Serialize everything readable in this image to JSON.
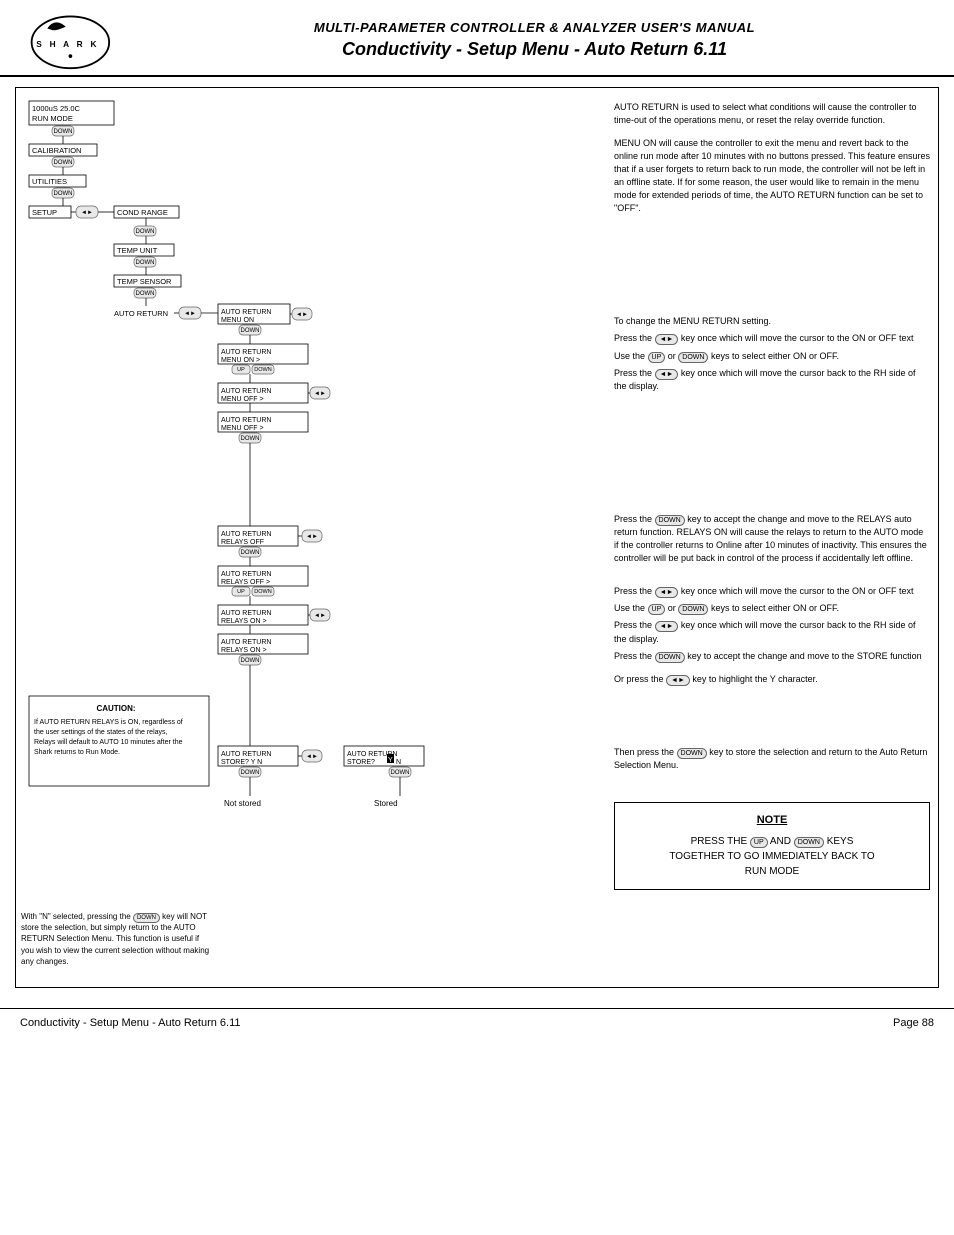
{
  "header": {
    "manual_title": "MULTI-PARAMETER CONTROLLER & ANALYZER USER'S MANUAL",
    "page_title": "Conductivity - Setup Menu - Auto Return 6.11",
    "logo_text": "SHARK"
  },
  "footer": {
    "left_text": "Conductivity - Setup Menu - Auto Return 6.11",
    "right_text": "Page 88"
  },
  "descriptions": {
    "auto_return_intro": "AUTO RETURN is used to select what conditions will cause the controller to time-out of the operations menu, or reset the relay override function.",
    "menu_on_desc": "MENU ON will cause the controller to exit the menu and revert back to the online run mode after 10 minutes with no buttons pressed. This feature ensures that if a user forgets to return back to run mode, the controller will not be left in an offline state. If for some reason, the user would like to remain in the menu mode for extended periods of time, the AUTO RETURN function can be set to \"OFF\".",
    "change_menu_return": "To change the MENU RETURN setting.",
    "press_enter_once": "Press the",
    "enter_key_label": "◄►",
    "move_cursor": "key once which will move the cursor to the ON or OFF text",
    "use_up_down": "Use the",
    "up_key": "▲",
    "or_text": "or",
    "down_key": "▼",
    "keys_text": "keys to select either ON or OFF.",
    "press_enter_rh": "Press the",
    "move_cursor_rh": "key once which will move the cursor back to the RH side of the display.",
    "press_down_accept": "Press the",
    "down_key2": "▼",
    "key_accept": "key to accept the change and move to the RELAYS auto return function. RELAYS ON will cause the relays to return to the AUTO mode if the controller returns to Online after 10 minutes of inactivity. This ensures the controller will be put back in control of the process if accidentally left offline.",
    "press_enter_once2": "Press the",
    "move_cursor2": "key once which will move the cursor to the ON or OFF text",
    "use_up_down2": "Use the",
    "keys_text2": "keys to select either ON or OFF.",
    "press_enter_rh2": "Press the",
    "move_cursor_rh2": "key once which will move the cursor back to the RH side of the display.",
    "press_down_accept2": "Press the",
    "accept_change2": "key to accept the change and move to the STORE function",
    "or_press_enter": "Or press the",
    "highlight_y": "key to highlight the Y character.",
    "with_n_selected": "With \"N\" selected, pressing the",
    "down_key3": "▼",
    "not_store": "key will NOT store the selection, but simply return to the AUTO RETURN Selection Menu. This function is useful if you wish to view the current selection without making any changes.",
    "stored_text": "Stored",
    "not_stored_text": "Not stored",
    "then_press_down": "Then press the",
    "store_return": "key to store the selection and return to the Auto Return Selection Menu.",
    "caution_title": "CAUTION:",
    "caution_text": "If AUTO RETURN RELAYS is ON, regardless of the user settings of the states of the relays, Relays will default to AUTO 10 minutes after the Shark returns to Run Mode.",
    "note_title": "NOTE",
    "note_text": "PRESS THE ▲ AND ▼ KEYS TOGETHER TO GO IMMEDIATELY BACK TO RUN MODE"
  },
  "displays": {
    "run_mode": {
      "line1": "1000uS  25.0C",
      "line2": "RUN MODE"
    },
    "calibration": "CALIBRATION",
    "utilities": "UTILITIES",
    "setup": "SETUP",
    "cond_range": "COND RANGE",
    "temp_unit": "TEMP UNIT",
    "temp_sensor": "TEMP SENSOR",
    "auto_return_label": "AUTO RETURN",
    "ar_menu1": {
      "line1": "AUTO RETURN",
      "line2": "MENU    ON"
    },
    "ar_menu2": {
      "line1": "AUTO RETURN",
      "line2": "MENU    ON",
      "cursor": ">"
    },
    "ar_menu_on": {
      "line1": "AUTO RETURN",
      "line2": "MENU    ON",
      "cursor": ">"
    },
    "ar_menu_off": {
      "line1": "AUTO RETURN",
      "line2": "MENU    OFF",
      "cursor": ">"
    },
    "ar_menu_off2": {
      "line1": "AUTO RETURN",
      "line2": "MENU    OFF",
      "cursor": ">"
    },
    "ar_relays_off": {
      "line1": "AUTO RETURN",
      "line2": "RELAYS  OFF"
    },
    "ar_relays_off_cursor": {
      "line1": "AUTO RETURN",
      "line2": "RELAYS  OFF",
      "cursor": ">"
    },
    "ar_relays_off2": {
      "line1": "AUTO RETURN",
      "line2": "RELAYS  OFF",
      "cursor": ">"
    },
    "ar_relays_on": {
      "line1": "AUTO RETURN",
      "line2": "RELAYS  ON",
      "cursor": ">"
    },
    "ar_relays_on2": {
      "line1": "AUTO RETURN",
      "line2": "RELAYS  ON",
      "cursor": ">"
    },
    "ar_store_yn": {
      "line1": "AUTO RETURN",
      "line2": "STORE?  Y N"
    },
    "ar_store_yn2": {
      "line1": "AUTO RETURN",
      "line2": "STORE?  Y N",
      "cursor_y": true
    },
    "ar_store_yn3": {
      "line1": "AUTO RETURN",
      "line2": "STORE?  Y N"
    },
    "ar_store_yn4": {
      "line1": "AUTO RETURN",
      "line2": "STORE?  Y N",
      "cursor_y": true
    }
  }
}
